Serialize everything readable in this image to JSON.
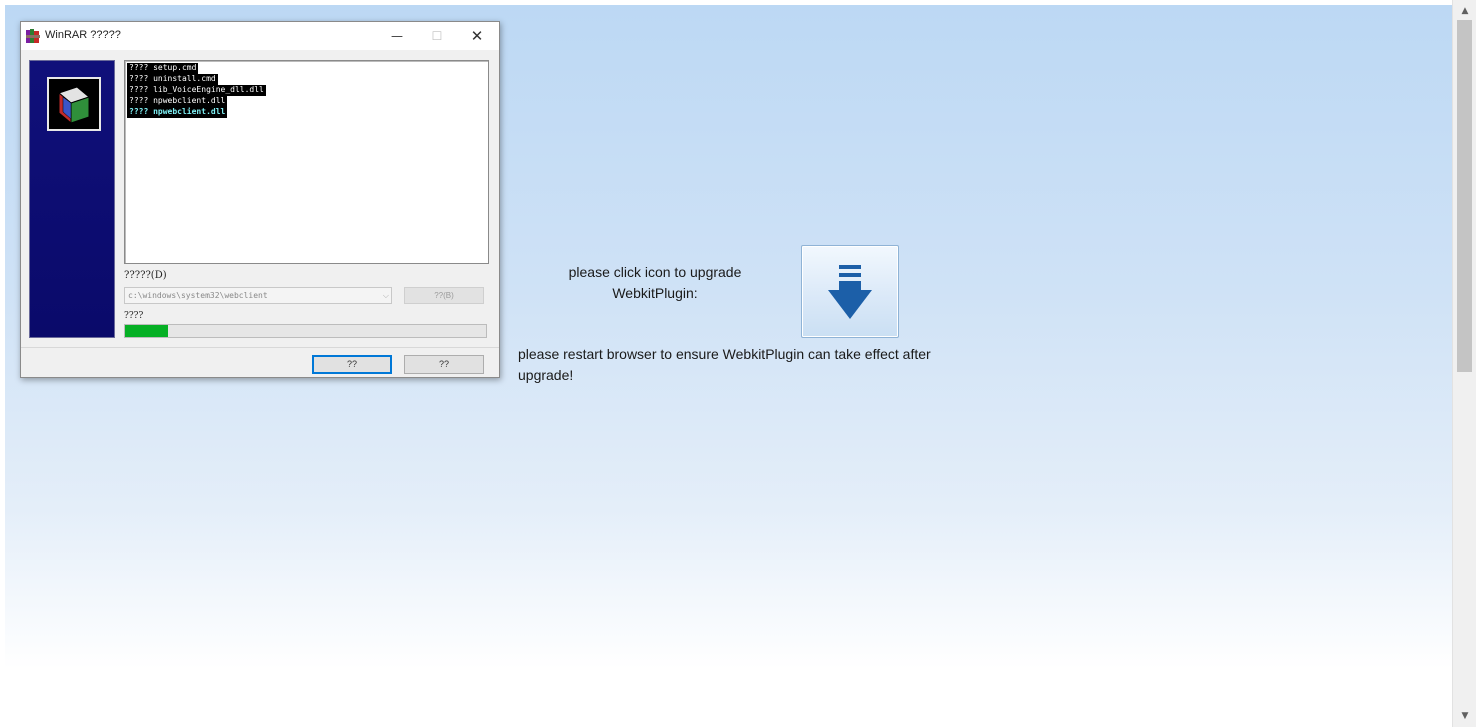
{
  "dialog": {
    "title": "WinRAR ?????",
    "app_icon": "winrar-books-icon",
    "log_lines": [
      "???? setup.cmd",
      "???? uninstall.cmd",
      "???? lib_VoiceEngine_dll.dll",
      "???? npwebclient.dll",
      "???? npwebclient.dll"
    ],
    "active_line_color": "#7ff0f4",
    "path_label": "?????(D)",
    "path_value": "c:\\windows\\system32\\webclient",
    "browse_label": "??(B)",
    "progress_label": "????",
    "progress_percent": 12,
    "progress_color": "#06b025",
    "ok_label": "??",
    "cancel_label": "??"
  },
  "main": {
    "prompt": "please click icon to upgrade WebkitPlugin:",
    "upgrade_icon": "download-arrow-icon",
    "upgrade_icon_color": "#1c5fa8",
    "restart_notice": "please restart browser to ensure WebkitPlugin can take effect after upgrade!"
  }
}
